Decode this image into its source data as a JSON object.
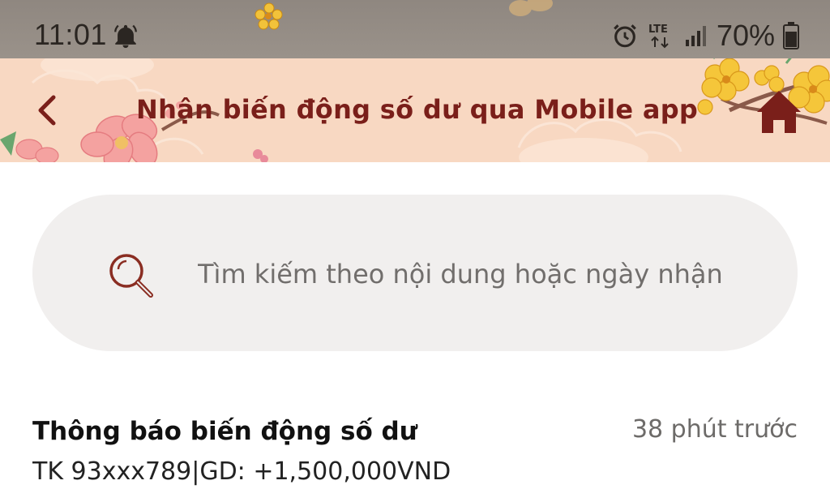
{
  "status_bar": {
    "time": "11:01",
    "battery_percent": "70%",
    "network": "LTE",
    "icons": [
      "bell-icon",
      "alarm-icon",
      "lte-icon",
      "signal-icon",
      "battery-icon"
    ]
  },
  "header": {
    "title": "Nhận biến động số dư qua Mobile app",
    "back_icon": "chevron-left-icon",
    "home_icon": "home-icon"
  },
  "search": {
    "placeholder": "Tìm kiếm theo nội dung hoặc ngày nhận",
    "value": "",
    "icon": "search-icon"
  },
  "notifications": [
    {
      "title": "Thông báo biến động số dư",
      "time": "38 phút trước",
      "body": "TK 93xxx789|GD: +1,500,000VND"
    }
  ],
  "colors": {
    "header_bg": "#f8d8c2",
    "status_bg": "#958d86",
    "accent": "#7a1f1a",
    "search_bg": "#f1efee"
  }
}
